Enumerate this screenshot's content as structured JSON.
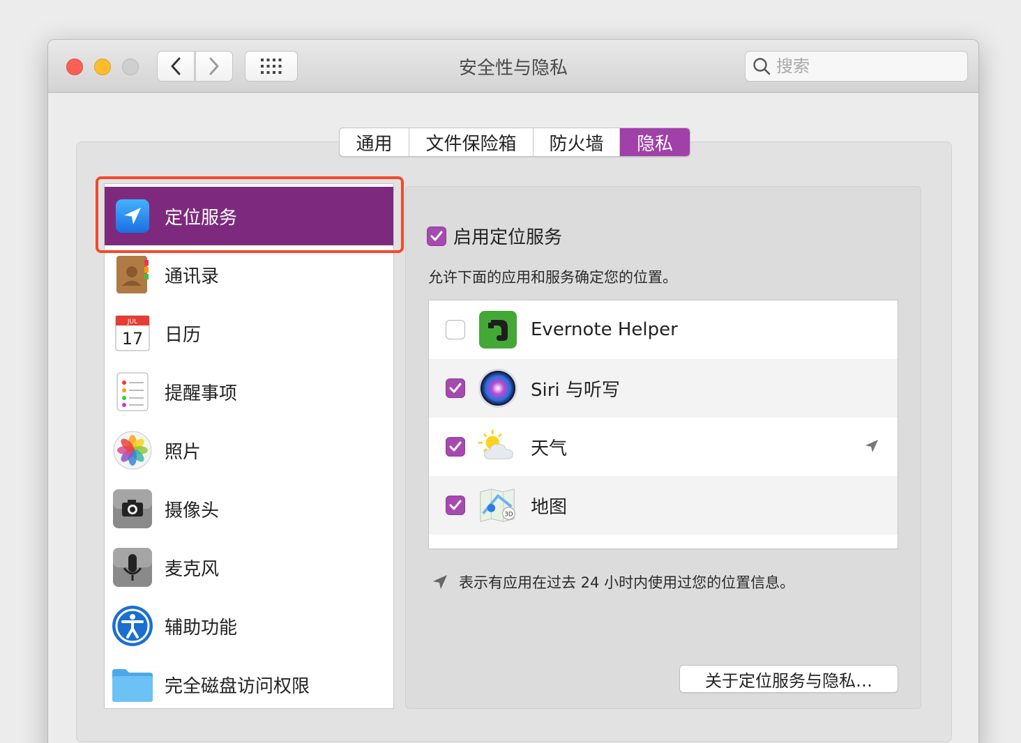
{
  "window": {
    "title": "安全性与隐私"
  },
  "toolbar": {
    "back_icon": "chevron-left-icon",
    "forward_icon": "chevron-right-icon",
    "grid_icon": "show-all-grid-icon"
  },
  "search": {
    "placeholder": "搜索",
    "value": ""
  },
  "tabs": [
    {
      "label": "通用",
      "active": false
    },
    {
      "label": "文件保险箱",
      "active": false
    },
    {
      "label": "防火墙",
      "active": false
    },
    {
      "label": "隐私",
      "active": true
    }
  ],
  "sidebar": {
    "items": [
      {
        "label": "定位服务",
        "icon": "location-arrow-icon",
        "selected": true
      },
      {
        "label": "通讯录",
        "icon": "contacts-book-icon"
      },
      {
        "label": "日历",
        "icon": "calendar-icon",
        "icon_month": "JUL",
        "icon_day": "17"
      },
      {
        "label": "提醒事项",
        "icon": "reminders-list-icon"
      },
      {
        "label": "照片",
        "icon": "photos-flower-icon"
      },
      {
        "label": "摄像头",
        "icon": "camera-icon"
      },
      {
        "label": "麦克风",
        "icon": "microphone-icon"
      },
      {
        "label": "辅助功能",
        "icon": "accessibility-icon"
      },
      {
        "label": "完全磁盘访问权限",
        "icon": "folder-icon"
      }
    ]
  },
  "location": {
    "enable_label": "启用定位服务",
    "enable_checked": true,
    "allow_text": "允许下面的应用和服务确定您的位置。",
    "apps": [
      {
        "name": "Evernote Helper",
        "checked": false,
        "icon": "evernote-elephant-icon",
        "recent": false
      },
      {
        "name": "Siri 与听写",
        "checked": true,
        "icon": "siri-orb-icon",
        "recent": false
      },
      {
        "name": "天气",
        "checked": true,
        "icon": "weather-sun-cloud-icon",
        "recent": true
      },
      {
        "name": "地图",
        "checked": true,
        "icon": "maps-icon",
        "recent": false
      }
    ],
    "footnote": "表示有应用在过去 24 小时内使用过您的位置信息。",
    "about_button": "关于定位服务与隐私…"
  },
  "colors": {
    "accent": "#a040a8",
    "selected_row": "#7d2a7e",
    "highlight_border": "#f24a2c"
  }
}
